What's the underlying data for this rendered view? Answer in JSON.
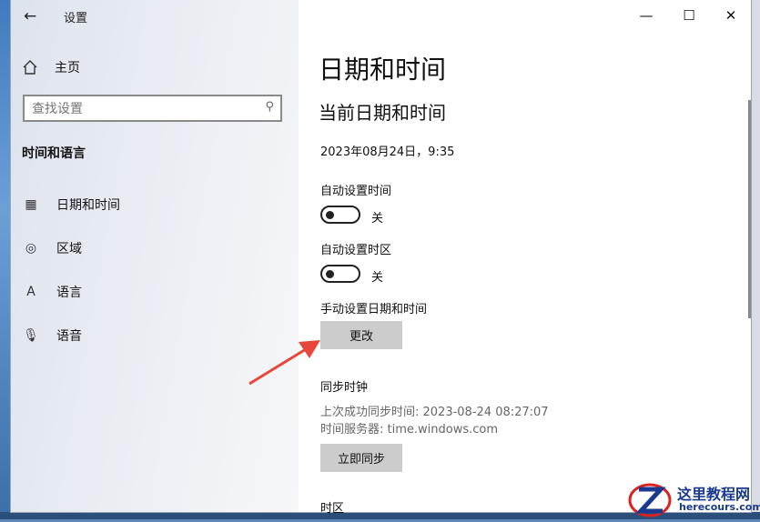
{
  "window": {
    "title": "设置",
    "controls": {
      "minimize": "—",
      "maximize": "☐",
      "close": "✕"
    }
  },
  "sidebar": {
    "home_label": "主页",
    "search_placeholder": "查找设置",
    "section_title": "时间和语言",
    "items": [
      {
        "label": "日期和时间",
        "icon": "calendar-clock-icon"
      },
      {
        "label": "区域",
        "icon": "globe-icon"
      },
      {
        "label": "语言",
        "icon": "language-icon"
      },
      {
        "label": "语音",
        "icon": "microphone-icon"
      }
    ]
  },
  "main": {
    "page_title": "日期和时间",
    "section_title": "当前日期和时间",
    "current_datetime": "2023年08月24日，9:35",
    "auto_time": {
      "label": "自动设置时间",
      "state": "关"
    },
    "auto_timezone": {
      "label": "自动设置时区",
      "state": "关"
    },
    "manual": {
      "label": "手动设置日期和时间",
      "button": "更改"
    },
    "sync": {
      "title": "同步时钟",
      "last_sync": "上次成功同步时间: 2023-08-24 08:27:07",
      "server": "时间服务器: time.windows.com",
      "button": "立即同步"
    },
    "timezone_label": "时区"
  },
  "watermark": {
    "name": "这里教程网",
    "url": "herecours.com"
  },
  "colors": {
    "arrow": "#e8463a",
    "button_bg": "#cccccc",
    "watermark": "#1a3a8f"
  }
}
